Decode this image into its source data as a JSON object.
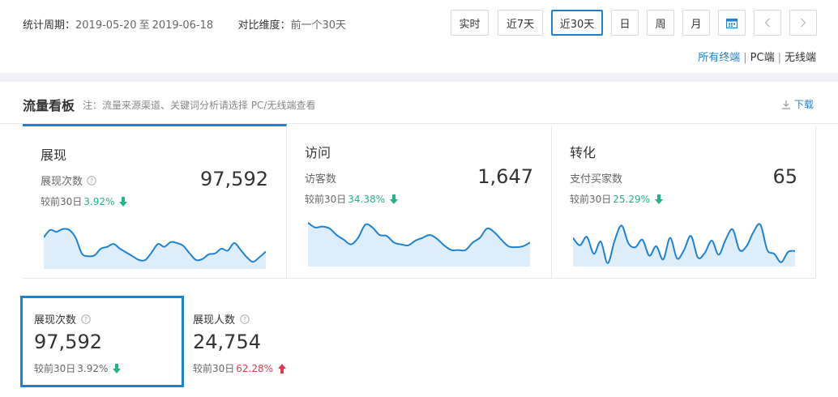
{
  "period": {
    "label": "统计周期：",
    "start": "2019-05-20",
    "sep": "至",
    "end": "2019-06-18",
    "compare_label": "对比维度：",
    "compare_value": "前一个30天"
  },
  "time_buttons": [
    {
      "label": "实时"
    },
    {
      "label": "近7天"
    },
    {
      "label": "近30天",
      "active": true
    },
    {
      "label": "日"
    },
    {
      "label": "周"
    },
    {
      "label": "月"
    }
  ],
  "terminals": {
    "all": "所有终端",
    "pc": "PC端",
    "wireless": "无线端",
    "divider": "|"
  },
  "panel": {
    "title": "流量看板",
    "note": "注：流量来源渠道、关键词分析请选择 PC/无线端查看",
    "download": "下载"
  },
  "cards": [
    {
      "title": "展现",
      "label": "展现次数",
      "value": "97,592",
      "compare_prefix": "较前30日",
      "compare_pct": "3.92%",
      "trend": "down",
      "spark": [
        0.62,
        0.78,
        0.74,
        0.8,
        0.78,
        0.62,
        0.28,
        0.22,
        0.24,
        0.38,
        0.42,
        0.48,
        0.38,
        0.3,
        0.22,
        0.14,
        0.14,
        0.3,
        0.48,
        0.42,
        0.52,
        0.5,
        0.44,
        0.28,
        0.14,
        0.16,
        0.26,
        0.28,
        0.38,
        0.34,
        0.5,
        0.36,
        0.2,
        0.1,
        0.2,
        0.32
      ]
    },
    {
      "title": "访问",
      "label": "访客数",
      "value": "1,647",
      "compare_prefix": "较前30日",
      "compare_pct": "34.38%",
      "trend": "down",
      "spark": [
        0.88,
        0.78,
        0.8,
        0.76,
        0.62,
        0.52,
        0.42,
        0.56,
        0.84,
        0.78,
        0.62,
        0.6,
        0.46,
        0.42,
        0.4,
        0.5,
        0.56,
        0.62,
        0.54,
        0.4,
        0.3,
        0.3,
        0.3,
        0.46,
        0.56,
        0.76,
        0.68,
        0.52,
        0.38,
        0.36,
        0.38,
        0.46
      ]
    },
    {
      "title": "转化",
      "label": "支付买家数",
      "value": "65",
      "compare_prefix": "较前30日",
      "compare_pct": "25.29%",
      "trend": "down",
      "spark": [
        0.56,
        0.4,
        0.58,
        0.22,
        0.48,
        0.02,
        0.5,
        0.82,
        0.44,
        0.36,
        0.52,
        0.18,
        0.38,
        0.1,
        0.56,
        0.12,
        0.3,
        0.6,
        0.14,
        0.24,
        0.5,
        0.2,
        0.52,
        0.74,
        0.3,
        0.38,
        0.68,
        0.84,
        0.3,
        0.22,
        0.04,
        0.26,
        0.28
      ]
    }
  ],
  "subs": [
    {
      "label": "展现次数",
      "value": "97,592",
      "compare_prefix": "较前30日",
      "compare_pct": "3.92%",
      "trend": "down"
    },
    {
      "label": "展现人数",
      "value": "24,754",
      "compare_prefix": "较前30日",
      "compare_pct": "62.28%",
      "trend": "up"
    }
  ],
  "colors": {
    "accent": "#1e82d2",
    "down": "#22b38a",
    "up": "#e03a4e",
    "spark_fill": "#deedfa"
  }
}
